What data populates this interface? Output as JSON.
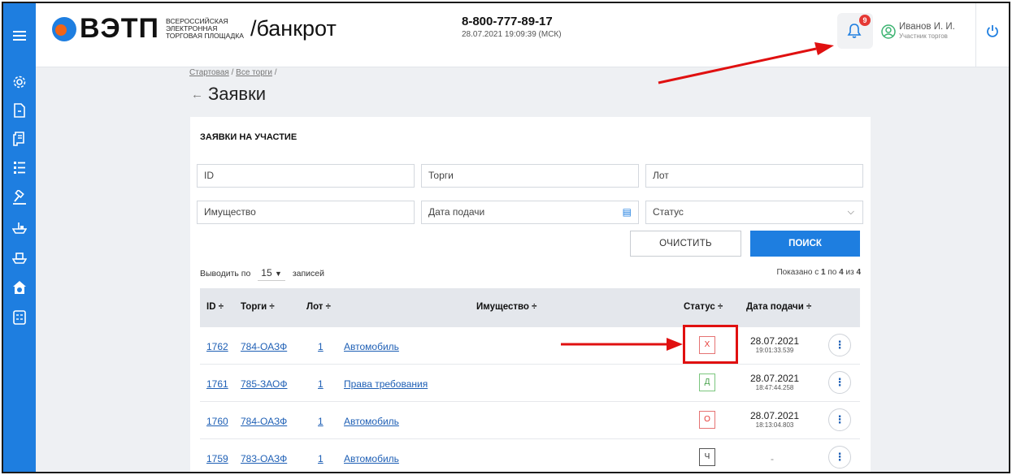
{
  "brand": {
    "name": "ВЭТП",
    "sub": [
      "ВСЕРОССИЙСКАЯ",
      "ЭЛЕКТРОННАЯ",
      "ТОРГОВАЯ ПЛОЩАДКА"
    ],
    "suffix": "/банкрот"
  },
  "header": {
    "phone": "8-800-777-89-17",
    "datetime": "28.07.2021 19:09:39 (МСК)",
    "notifications_count": "9",
    "user_name": "Иванов И. И.",
    "user_role": "Участник торгов"
  },
  "sidebar_icons": [
    "gear-icon",
    "document-icon",
    "scroll-icon",
    "list-icon",
    "gavel-icon",
    "ship-icon",
    "ship-alt-icon",
    "house-money-icon",
    "calculator-icon"
  ],
  "breadcrumb": {
    "home": "Стартовая",
    "all": "Все торги",
    "sep": "/"
  },
  "page_title": "Заявки",
  "section_title": "ЗАЯВКИ НА УЧАСТИЕ",
  "filters": {
    "id": "ID",
    "auction": "Торги",
    "lot": "Лот",
    "property": "Имущество",
    "date": "Дата подачи",
    "status": "Статус"
  },
  "buttons": {
    "clear": "ОЧИСТИТЬ",
    "search": "ПОИСК"
  },
  "pagination": {
    "prefix": "Выводить по",
    "per_page": "15",
    "suffix": "записей",
    "shown_pre": "Показано с",
    "from": "1",
    "mid": "по",
    "to": "4",
    "of_word": "из",
    "total": "4"
  },
  "columns": {
    "id": "ID ÷",
    "auction": "Торги ÷",
    "lot": "Лот ÷",
    "property": "Имущество ÷",
    "status": "Статус ÷",
    "date": "Дата подачи ÷"
  },
  "rows": [
    {
      "id": "1762",
      "auction": "784-ОАЗФ",
      "lot": "1",
      "property": "Автомобиль",
      "status": "Х",
      "date": "28.07.2021",
      "time": "19:01:33.539"
    },
    {
      "id": "1761",
      "auction": "785-ЗАОФ",
      "lot": "1",
      "property": "Права требования",
      "status": "Д",
      "date": "28.07.2021",
      "time": "18:47:44.258"
    },
    {
      "id": "1760",
      "auction": "784-ОАЗФ",
      "lot": "1",
      "property": "Автомобиль",
      "status": "О",
      "date": "28.07.2021",
      "time": "18:13:04.803"
    },
    {
      "id": "1759",
      "auction": "783-ОАЗФ",
      "lot": "1",
      "property": "Автомобиль",
      "status": "Ч",
      "date": "-",
      "time": ""
    }
  ],
  "colors": {
    "primary": "#1e7ee0",
    "annotation": "#e01010"
  }
}
